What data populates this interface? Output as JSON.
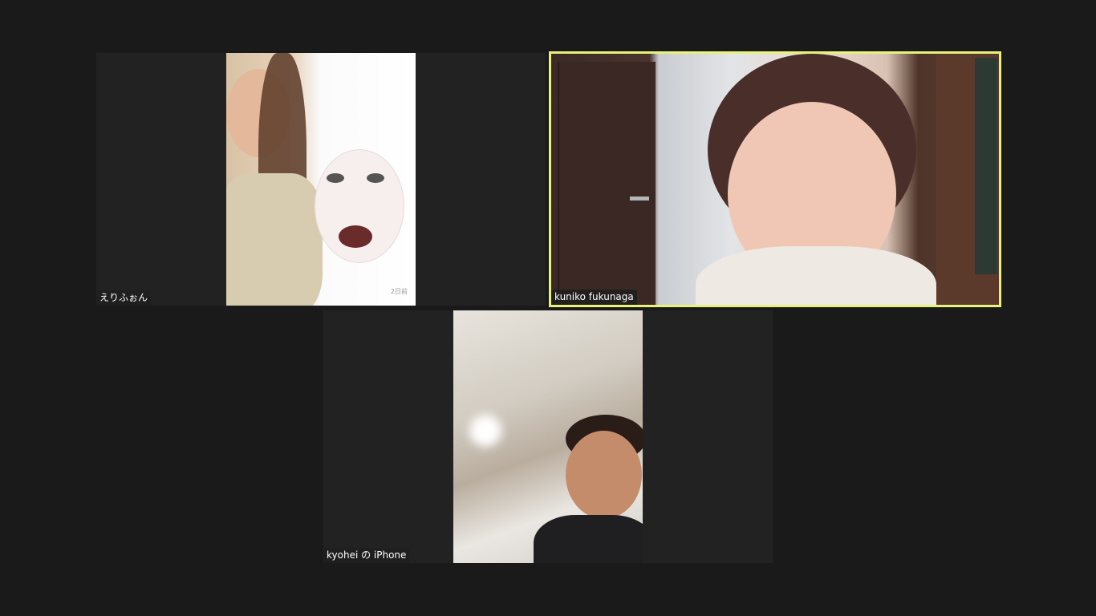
{
  "window": {
    "background_color": "#1a1a1a",
    "active_speaker_border_color": "#e8f27a"
  },
  "participants": [
    {
      "name": "えりふぉん",
      "video_overlay_text": "2日前",
      "active_speaker": false
    },
    {
      "name": "kuniko fukunaga",
      "active_speaker": true
    },
    {
      "name": "kyohei の iPhone",
      "active_speaker": false
    }
  ]
}
